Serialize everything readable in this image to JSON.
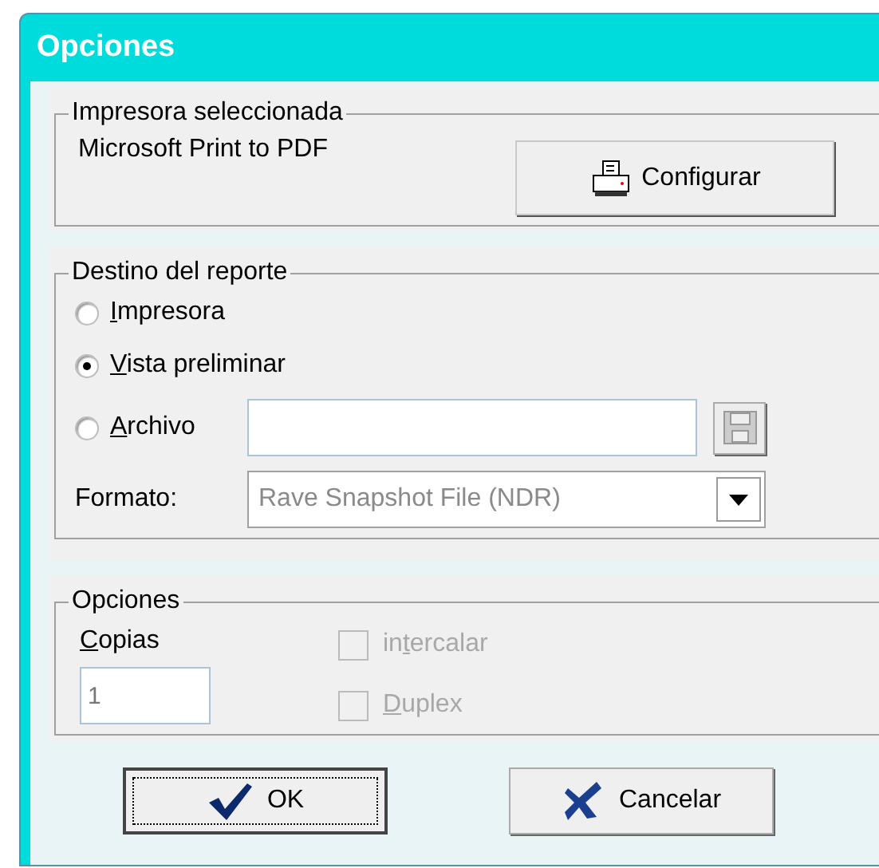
{
  "window": {
    "title": "Opciones"
  },
  "printer_group": {
    "title": "Impresora seleccionada",
    "printer_name": "Microsoft Print to PDF",
    "configure_button": "Configurar"
  },
  "destination_group": {
    "title": "Destino del reporte",
    "options": [
      {
        "label": {
          "key": "I",
          "after": "mpresora"
        },
        "selected": false
      },
      {
        "label": {
          "key": "V",
          "after": "ista preliminar"
        },
        "selected": true
      },
      {
        "label": {
          "key": "A",
          "after": "rchivo"
        },
        "selected": false
      }
    ],
    "format_label": "Formato:",
    "format_value": "Rave Snapshot File (NDR)"
  },
  "options_group": {
    "title": "Opciones",
    "copies_label": {
      "key": "C",
      "after": "opias"
    },
    "copies_value": "1",
    "checkboxes": [
      {
        "label": {
          "before": "in",
          "key": "t",
          "after": "ercalar"
        },
        "checked": false,
        "disabled": true
      },
      {
        "label": {
          "key": "D",
          "after": "uplex"
        },
        "checked": false,
        "disabled": true
      }
    ]
  },
  "buttons": [
    {
      "label": "OK",
      "kind": "ok",
      "focused": true
    },
    {
      "label": "Cancelar",
      "kind": "cancel",
      "focused": false
    }
  ]
}
